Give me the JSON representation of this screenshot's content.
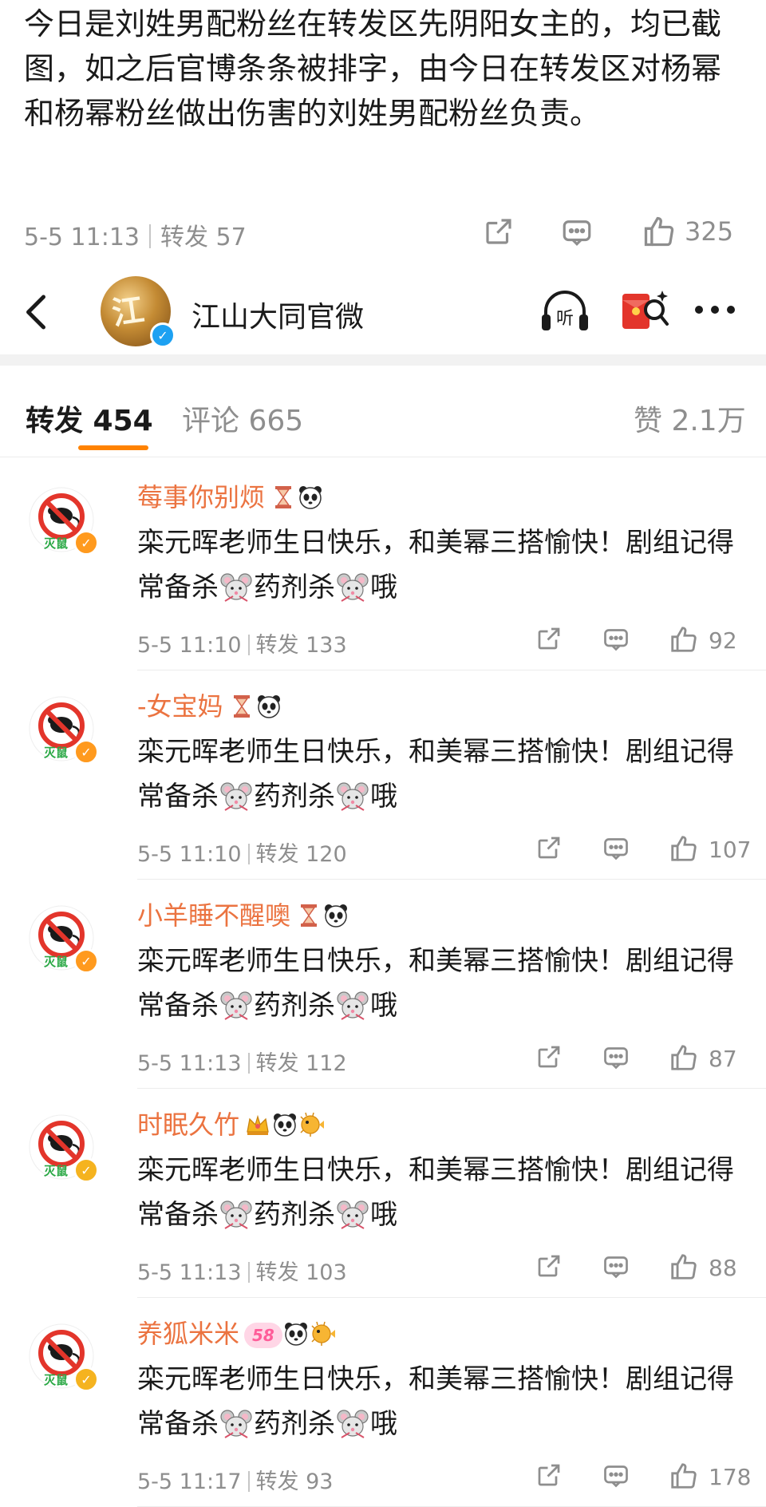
{
  "post": {
    "text": "今日是刘姓男配粉丝在转发区先阴阳女主的，均已截图，如之后官博条条被排字，由今日在转发区对杨幂和杨幂粉丝做出伤害的刘姓男配粉丝负责。",
    "time": "5-5 11:13",
    "repost_label": "转发 57",
    "likes": "325"
  },
  "header": {
    "account_name": "江山大同官微",
    "avatar_glyph": "江",
    "listen_label": "听"
  },
  "tabs": {
    "repost": "转发 454",
    "comment": "评论 665",
    "like": "赞 2.1万"
  },
  "reposts": [
    {
      "name": "莓事你别烦",
      "text_a": "栾元晖老师生日快乐，和美幂三搭愉快！剧组记得常备杀",
      "text_b": "药剂杀",
      "text_c": "哦",
      "time": "5-5 11:10",
      "repost": "转发 133",
      "likes": "92",
      "badges": [
        "hourglass-icon",
        "panda-icon"
      ]
    },
    {
      "name": "-女宝妈",
      "text_a": "栾元晖老师生日快乐，和美幂三搭愉快！剧组记得常备杀",
      "text_b": "药剂杀",
      "text_c": "哦",
      "time": "5-5 11:10",
      "repost": "转发 120",
      "likes": "107",
      "badges": [
        "hourglass-icon",
        "panda-icon"
      ]
    },
    {
      "name": "小羊睡不醒噢",
      "text_a": "栾元晖老师生日快乐，和美幂三搭愉快！剧组记得常备杀",
      "text_b": "药剂杀",
      "text_c": "哦",
      "time": "5-5 11:13",
      "repost": "转发 112",
      "likes": "87",
      "badges": [
        "hourglass-icon",
        "panda-icon"
      ]
    },
    {
      "name": "时眠久竹",
      "text_a": "栾元晖老师生日快乐，和美幂三搭愉快！剧组记得常备杀",
      "text_b": "药剂杀",
      "text_c": "哦",
      "time": "5-5 11:13",
      "repost": "转发 103",
      "likes": "88",
      "badges": [
        "crown-icon",
        "panda-icon",
        "pufferfish-icon"
      ]
    },
    {
      "name": "养狐米米",
      "text_a": "栾元晖老师生日快乐，和美幂三搭愉快！剧组记得常备杀",
      "text_b": "药剂杀",
      "text_c": "哦",
      "time": "5-5 11:17",
      "repost": "转发 93",
      "likes": "178",
      "badges": [
        "level-badge-icon",
        "panda-icon",
        "pufferfish-icon"
      ],
      "level": "58"
    }
  ],
  "avatar_caption": "灭鼠",
  "colors": {
    "accent": "#ff8200",
    "username": "#eb7340",
    "verified_orange": "#ff9a1e",
    "verified_blue": "#1da1f2",
    "avatar_red": "#e3352b"
  }
}
